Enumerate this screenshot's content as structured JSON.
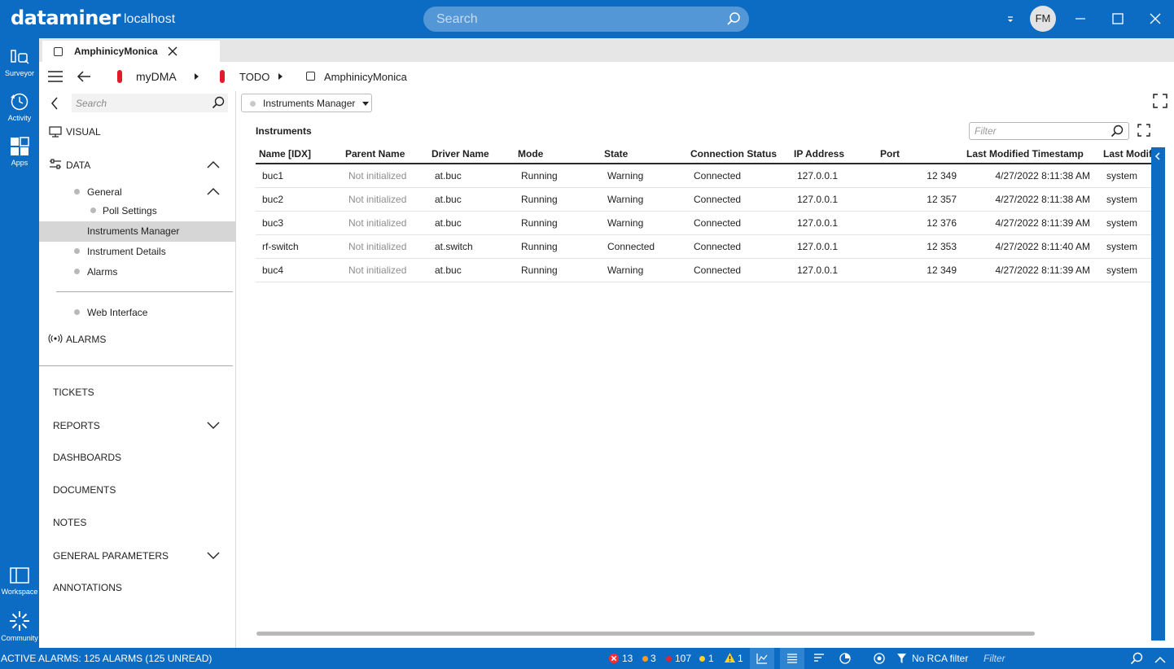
{
  "app": {
    "brand": "dataminer",
    "host": "localhost",
    "search_placeholder": "Search",
    "user_initials": "FM"
  },
  "rail": {
    "items": [
      {
        "label": "Surveyor",
        "icon": "surveyor-icon"
      },
      {
        "label": "Activity",
        "icon": "history-icon"
      },
      {
        "label": "Apps",
        "icon": "apps-grid-icon"
      }
    ],
    "bottom_items": [
      {
        "label": "Workspace",
        "icon": "workspace-icon"
      },
      {
        "label": "Community",
        "icon": "community-icon"
      }
    ]
  },
  "tabs": [
    {
      "label": "AmphinicyMonica"
    }
  ],
  "breadcrumb": {
    "items": [
      "myDMA",
      "TODO",
      "AmphinicyMonica"
    ]
  },
  "sidepanel": {
    "search_placeholder": "Search",
    "visual_label": "VISUAL",
    "data_label": "DATA",
    "general_label": "General",
    "poll_settings_label": "Poll Settings",
    "instruments_manager_label": "Instruments Manager",
    "instrument_details_label": "Instrument Details",
    "alarms_sub_label": "Alarms",
    "web_interface_label": "Web Interface",
    "alarms_label": "ALARMS",
    "tickets_label": "TICKETS",
    "reports_label": "REPORTS",
    "dashboards_label": "DASHBOARDS",
    "documents_label": "DOCUMENTS",
    "notes_label": "NOTES",
    "general_parameters_label": "GENERAL PARAMETERS",
    "annotations_label": "ANNOTATIONS"
  },
  "main": {
    "page_selector": "Instruments Manager",
    "section_title": "Instruments",
    "filter_placeholder": "Filter",
    "columns": [
      "Name [IDX]",
      "Parent Name",
      "Driver Name",
      "Mode",
      "State",
      "Connection Status",
      "IP Address",
      "Port",
      "Last Modified Timestamp",
      "Last Modifi"
    ],
    "rows": [
      {
        "name": "buc1",
        "parent": "Not initialized",
        "driver": "at.buc",
        "mode": "Running",
        "state": "Warning",
        "conn": "Connected",
        "ip": "127.0.0.1",
        "port": "12 349",
        "ts": "4/27/2022 8:11:38 AM",
        "by": "system"
      },
      {
        "name": "buc2",
        "parent": "Not initialized",
        "driver": "at.buc",
        "mode": "Running",
        "state": "Warning",
        "conn": "Connected",
        "ip": "127.0.0.1",
        "port": "12 357",
        "ts": "4/27/2022 8:11:38 AM",
        "by": "system"
      },
      {
        "name": "buc3",
        "parent": "Not initialized",
        "driver": "at.buc",
        "mode": "Running",
        "state": "Warning",
        "conn": "Connected",
        "ip": "127.0.0.1",
        "port": "12 376",
        "ts": "4/27/2022 8:11:39 AM",
        "by": "system"
      },
      {
        "name": "rf-switch",
        "parent": "Not initialized",
        "driver": "at.switch",
        "mode": "Running",
        "state": "Connected",
        "conn": "Connected",
        "ip": "127.0.0.1",
        "port": "12 353",
        "ts": "4/27/2022 8:11:40 AM",
        "by": "system"
      },
      {
        "name": "buc4",
        "parent": "Not initialized",
        "driver": "at.buc",
        "mode": "Running",
        "state": "Warning",
        "conn": "Connected",
        "ip": "127.0.0.1",
        "port": "12 349",
        "ts": "4/27/2022 8:11:39 AM",
        "by": "system"
      }
    ]
  },
  "statusbar": {
    "active_alarms": "ACTIVE ALARMS: 125 ALARMS (125 UNREAD)",
    "critical_count": "13",
    "major_count": "3",
    "minor_count": "107",
    "warning_count": "1",
    "notice_count": "1",
    "rca_filter": "No RCA filter",
    "filter_placeholder": "Filter",
    "colors": {
      "critical": "#ff2a2a",
      "major": "#ff9a1f",
      "minor": "#e8232c",
      "warning": "#ffd21f"
    }
  }
}
